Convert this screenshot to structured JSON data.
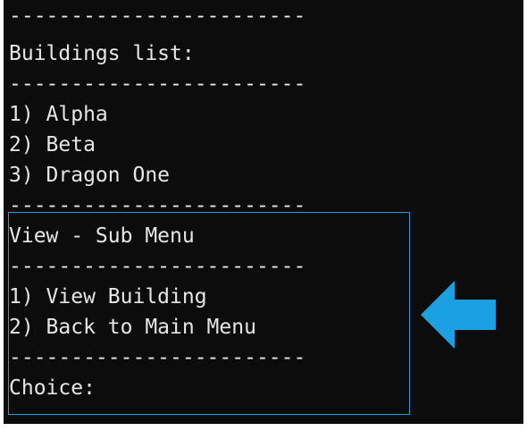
{
  "console": {
    "lines": [
      "------------------------",
      "Buildings list:",
      "------------------------",
      "1) Alpha",
      "2) Beta",
      "3) Dragon One",
      "------------------------",
      "View - Sub Menu",
      "------------------------",
      "1) View Building",
      "2) Back to Main Menu",
      "------------------------",
      "Choice:"
    ]
  },
  "annotation": {
    "box_color": "#1ba1e2",
    "arrow_color": "#1ba1e2",
    "arrow_icon": "arrow-left-icon"
  }
}
